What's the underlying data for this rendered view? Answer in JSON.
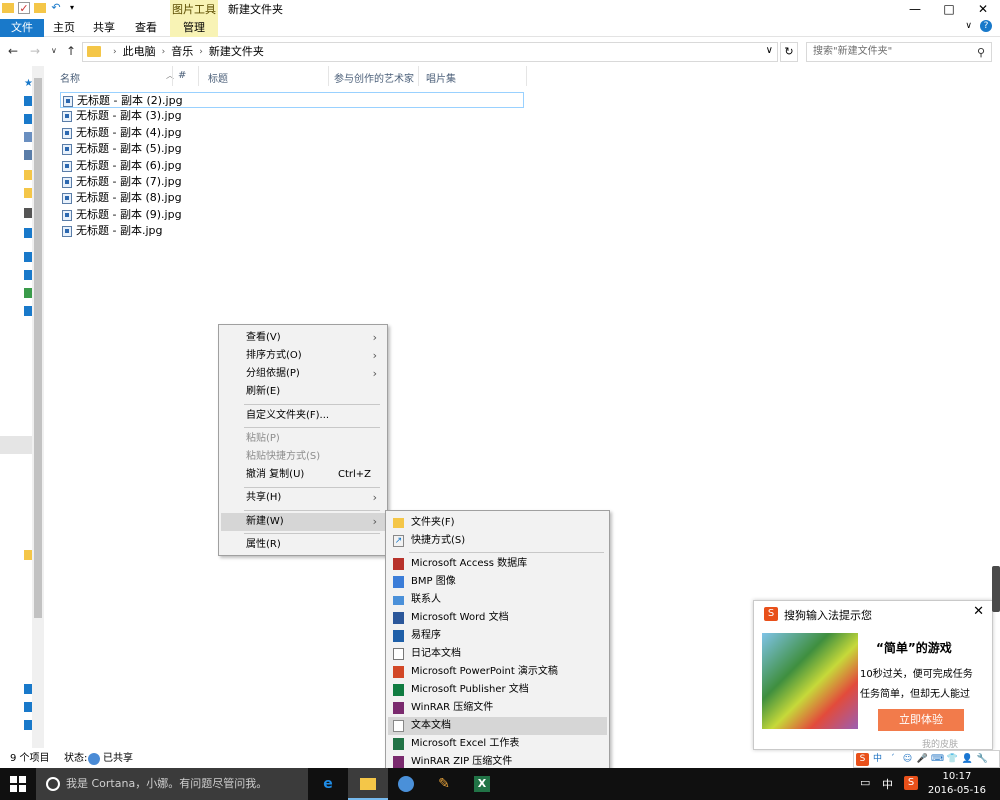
{
  "titlebar": {
    "context_tab_group": "图片工具",
    "window_title": "新建文件夹",
    "minimize": "—",
    "maximize": "□",
    "close": "✕"
  },
  "ribbon": {
    "tabs": [
      "文件",
      "主页",
      "共享",
      "查看",
      "管理"
    ],
    "help": "?"
  },
  "address": {
    "crumbs": [
      "此电脑",
      "音乐",
      "新建文件夹"
    ],
    "search_placeholder": "搜索\"新建文件夹\""
  },
  "columns": [
    "名称",
    "#",
    "标题",
    "参与创作的艺术家",
    "唱片集"
  ],
  "files": [
    "无标题 - 副本 (2).jpg",
    "无标题 - 副本 (3).jpg",
    "无标题 - 副本 (4).jpg",
    "无标题 - 副本 (5).jpg",
    "无标题 - 副本 (6).jpg",
    "无标题 - 副本 (7).jpg",
    "无标题 - 副本 (8).jpg",
    "无标题 - 副本 (9).jpg",
    "无标题 - 副本.jpg"
  ],
  "context_menu": {
    "view": "查看(V)",
    "sort": "排序方式(O)",
    "group": "分组依据(P)",
    "refresh": "刷新(E)",
    "customize": "自定义文件夹(F)...",
    "paste": "粘贴(P)",
    "paste_shortcut": "粘贴快捷方式(S)",
    "undo": "撤消 复制(U)",
    "undo_shortcut": "Ctrl+Z",
    "share": "共享(H)",
    "new": "新建(W)",
    "properties": "属性(R)"
  },
  "submenu": {
    "folder": "文件夹(F)",
    "shortcut": "快捷方式(S)",
    "items": [
      "Microsoft Access 数据库",
      "BMP 图像",
      "联系人",
      "Microsoft Word 文档",
      "易程序",
      "日记本文档",
      "Microsoft PowerPoint 演示文稿",
      "Microsoft Publisher 文档",
      "WinRAR 压缩文件",
      "文本文档",
      "Microsoft Excel 工作表",
      "WinRAR ZIP 压缩文件"
    ]
  },
  "statusbar": {
    "item_count": "9 个项目",
    "state_label": "状态:",
    "state_value": "已共享"
  },
  "sogou_popup": {
    "logo": "S",
    "title": "搜狗输入法提示您",
    "close": "✕",
    "game_title": "“简单”的游戏",
    "desc_line1": "10秒过关，便可完成任务",
    "desc_line2": "任务简单，但却无人能过",
    "button": "立即体验",
    "skin": "我的皮肤"
  },
  "sogou_bar": [
    "S",
    "中",
    "ˊ",
    "☺",
    "🎤",
    "⌨",
    "👕",
    "👤",
    "🔧"
  ],
  "taskbar": {
    "cortana": "我是 Cortana，小娜。有问题尽管问我。",
    "ime": "中",
    "time": "10:17",
    "date": "2016-05-16"
  },
  "colors": {
    "accent": "#1979ca",
    "context_tab": "#f8f3b5",
    "menu_bg": "#f2f2f2",
    "menu_highlight": "#d6d6d6",
    "taskbar": "#101010",
    "sogou_orange": "#f27b4b"
  }
}
